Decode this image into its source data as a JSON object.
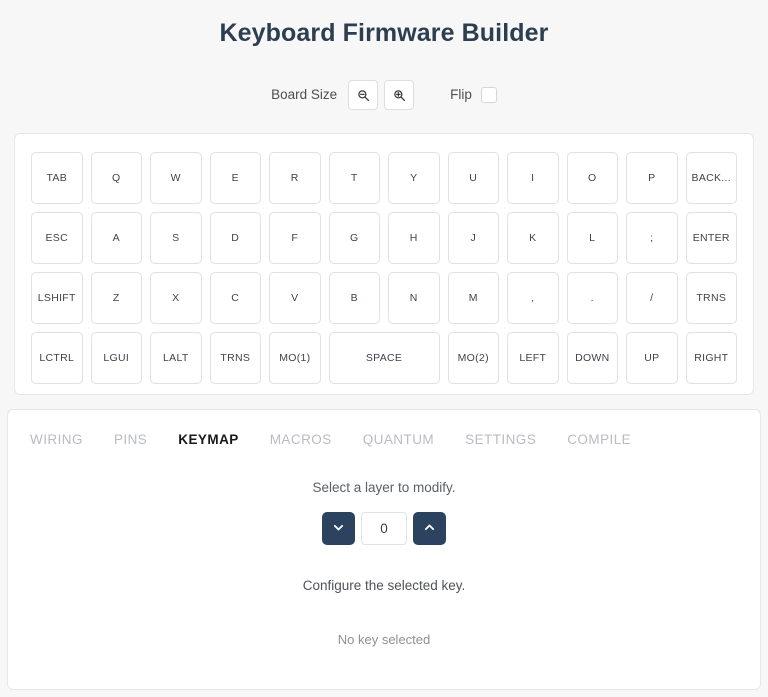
{
  "header": {
    "title": "Keyboard Firmware Builder"
  },
  "toolbar": {
    "board_size_label": "Board Size",
    "zoom_out_icon": "zoom-out-icon",
    "zoom_in_icon": "zoom-in-icon",
    "flip_label": "Flip",
    "flip_checked": false
  },
  "keyboard": {
    "rows": [
      {
        "keys": [
          {
            "label": "TAB",
            "width": 1
          },
          {
            "label": "Q",
            "width": 1
          },
          {
            "label": "W",
            "width": 1
          },
          {
            "label": "E",
            "width": 1
          },
          {
            "label": "R",
            "width": 1
          },
          {
            "label": "T",
            "width": 1
          },
          {
            "label": "Y",
            "width": 1
          },
          {
            "label": "U",
            "width": 1
          },
          {
            "label": "I",
            "width": 1
          },
          {
            "label": "O",
            "width": 1
          },
          {
            "label": "P",
            "width": 1
          },
          {
            "label": "BACK...",
            "width": 1
          }
        ]
      },
      {
        "keys": [
          {
            "label": "ESC",
            "width": 1
          },
          {
            "label": "A",
            "width": 1
          },
          {
            "label": "S",
            "width": 1
          },
          {
            "label": "D",
            "width": 1
          },
          {
            "label": "F",
            "width": 1
          },
          {
            "label": "G",
            "width": 1
          },
          {
            "label": "H",
            "width": 1
          },
          {
            "label": "J",
            "width": 1
          },
          {
            "label": "K",
            "width": 1
          },
          {
            "label": "L",
            "width": 1
          },
          {
            "label": ";",
            "width": 1
          },
          {
            "label": "ENTER",
            "width": 1
          }
        ]
      },
      {
        "keys": [
          {
            "label": "LSHIFT",
            "width": 1
          },
          {
            "label": "Z",
            "width": 1
          },
          {
            "label": "X",
            "width": 1
          },
          {
            "label": "C",
            "width": 1
          },
          {
            "label": "V",
            "width": 1
          },
          {
            "label": "B",
            "width": 1
          },
          {
            "label": "N",
            "width": 1
          },
          {
            "label": "M",
            "width": 1
          },
          {
            "label": ",",
            "width": 1
          },
          {
            "label": ".",
            "width": 1
          },
          {
            "label": "/",
            "width": 1
          },
          {
            "label": "TRNS",
            "width": 1
          }
        ]
      },
      {
        "keys": [
          {
            "label": "LCTRL",
            "width": 1
          },
          {
            "label": "LGUI",
            "width": 1
          },
          {
            "label": "LALT",
            "width": 1
          },
          {
            "label": "TRNS",
            "width": 1
          },
          {
            "label": "MO(1)",
            "width": 1
          },
          {
            "label": "SPACE",
            "width": 2
          },
          {
            "label": "MO(2)",
            "width": 1
          },
          {
            "label": "LEFT",
            "width": 1
          },
          {
            "label": "DOWN",
            "width": 1
          },
          {
            "label": "UP",
            "width": 1
          },
          {
            "label": "RIGHT",
            "width": 1
          }
        ]
      }
    ]
  },
  "tabs": [
    {
      "label": "WIRING",
      "active": false
    },
    {
      "label": "PINS",
      "active": false
    },
    {
      "label": "KEYMAP",
      "active": true
    },
    {
      "label": "MACROS",
      "active": false
    },
    {
      "label": "QUANTUM",
      "active": false
    },
    {
      "label": "SETTINGS",
      "active": false
    },
    {
      "label": "COMPILE",
      "active": false
    }
  ],
  "keymap_panel": {
    "layer_prompt": "Select a layer to modify.",
    "layer_value": "0",
    "layer_down_icon": "chevron-down-icon",
    "layer_up_icon": "chevron-up-icon",
    "configure_prompt": "Configure the selected key.",
    "no_key_selected": "No key selected"
  },
  "colors": {
    "accent_dark": "#2c4360",
    "title": "#2c3e50",
    "page_bg": "#f7f7f8",
    "panel_bg": "#ffffff",
    "tab_inactive": "#b9bcc0",
    "tab_active": "#18191b"
  }
}
